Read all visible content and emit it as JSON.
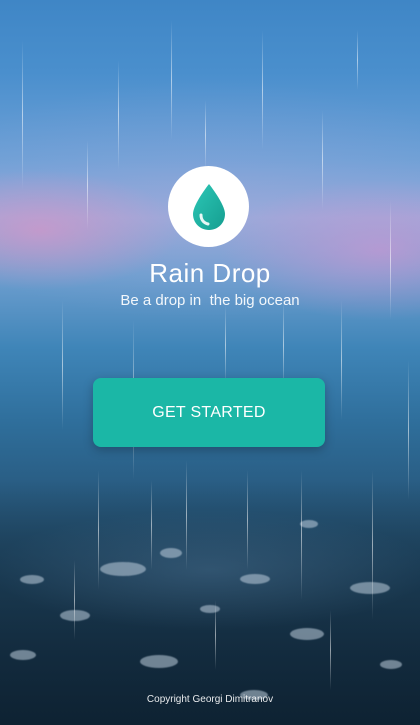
{
  "app": {
    "title": "Rain Drop",
    "tagline": "Be a drop in  the big ocean"
  },
  "actions": {
    "get_started_label": "GET STARTED"
  },
  "footer": {
    "copyright": "Copyright Georgi Dimitranov"
  },
  "icons": {
    "logo": "water-drop-icon"
  },
  "colors": {
    "accent": "#1bb7a6",
    "drop": "#20b2a3",
    "text": "#ffffff"
  }
}
